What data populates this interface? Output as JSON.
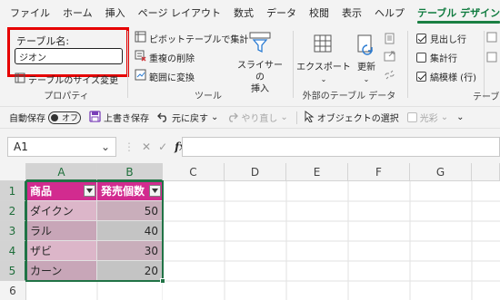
{
  "menu": {
    "tabs": [
      "ファイル",
      "ホーム",
      "挿入",
      "ページ レイアウト",
      "数式",
      "データ",
      "校閲",
      "表示",
      "ヘルプ",
      "テーブル デザイン"
    ],
    "active_index": 9
  },
  "ribbon": {
    "properties": {
      "table_name_label": "テーブル名:",
      "table_name_value": "ジオン",
      "resize_label": "テーブルのサイズ変更",
      "group_label": "プロパティ"
    },
    "tools": {
      "pivot_label": "ピボットテーブルで集計",
      "remove_dup_label": "重複の削除",
      "convert_range_label": "範囲に変換",
      "slicer_label_line1": "スライサーの",
      "slicer_label_line2": "挿入",
      "group_label": "ツール"
    },
    "external": {
      "export_label": "エクスポート",
      "refresh_label": "更新",
      "group_label": "外部のテーブル データ"
    },
    "style_options": {
      "header_row_label": "見出し行",
      "total_row_label": "集計行",
      "banded_rows_label": "縞模様 (行)",
      "header_row_checked": true,
      "total_row_checked": false,
      "banded_rows_checked": true,
      "group_label": "テーブ"
    }
  },
  "qat": {
    "autosave_label": "自動保存",
    "autosave_state": "オフ",
    "save_label": "上書き保存",
    "undo_label": "元に戻す",
    "redo_label": "やり直し",
    "select_objects_label": "オブジェクトの選択",
    "gloss_label": "光彩"
  },
  "formula_bar": {
    "name_box": "A1",
    "fx": "fx",
    "formula": ""
  },
  "grid": {
    "columns": [
      "A",
      "B",
      "C",
      "D",
      "E",
      "F",
      "G"
    ],
    "rows": [
      "1",
      "2",
      "3",
      "4",
      "5",
      "6"
    ],
    "table": {
      "headers": [
        "商品",
        "発売個数"
      ],
      "rows": [
        [
          "ダイクン",
          "50"
        ],
        [
          "ラル",
          "40"
        ],
        [
          "ザビ",
          "30"
        ],
        [
          "カーン",
          "20"
        ]
      ]
    }
  },
  "colors": {
    "accent_green": "#217346",
    "table_header": "#d22b8f",
    "highlight_red": "#e60000"
  }
}
